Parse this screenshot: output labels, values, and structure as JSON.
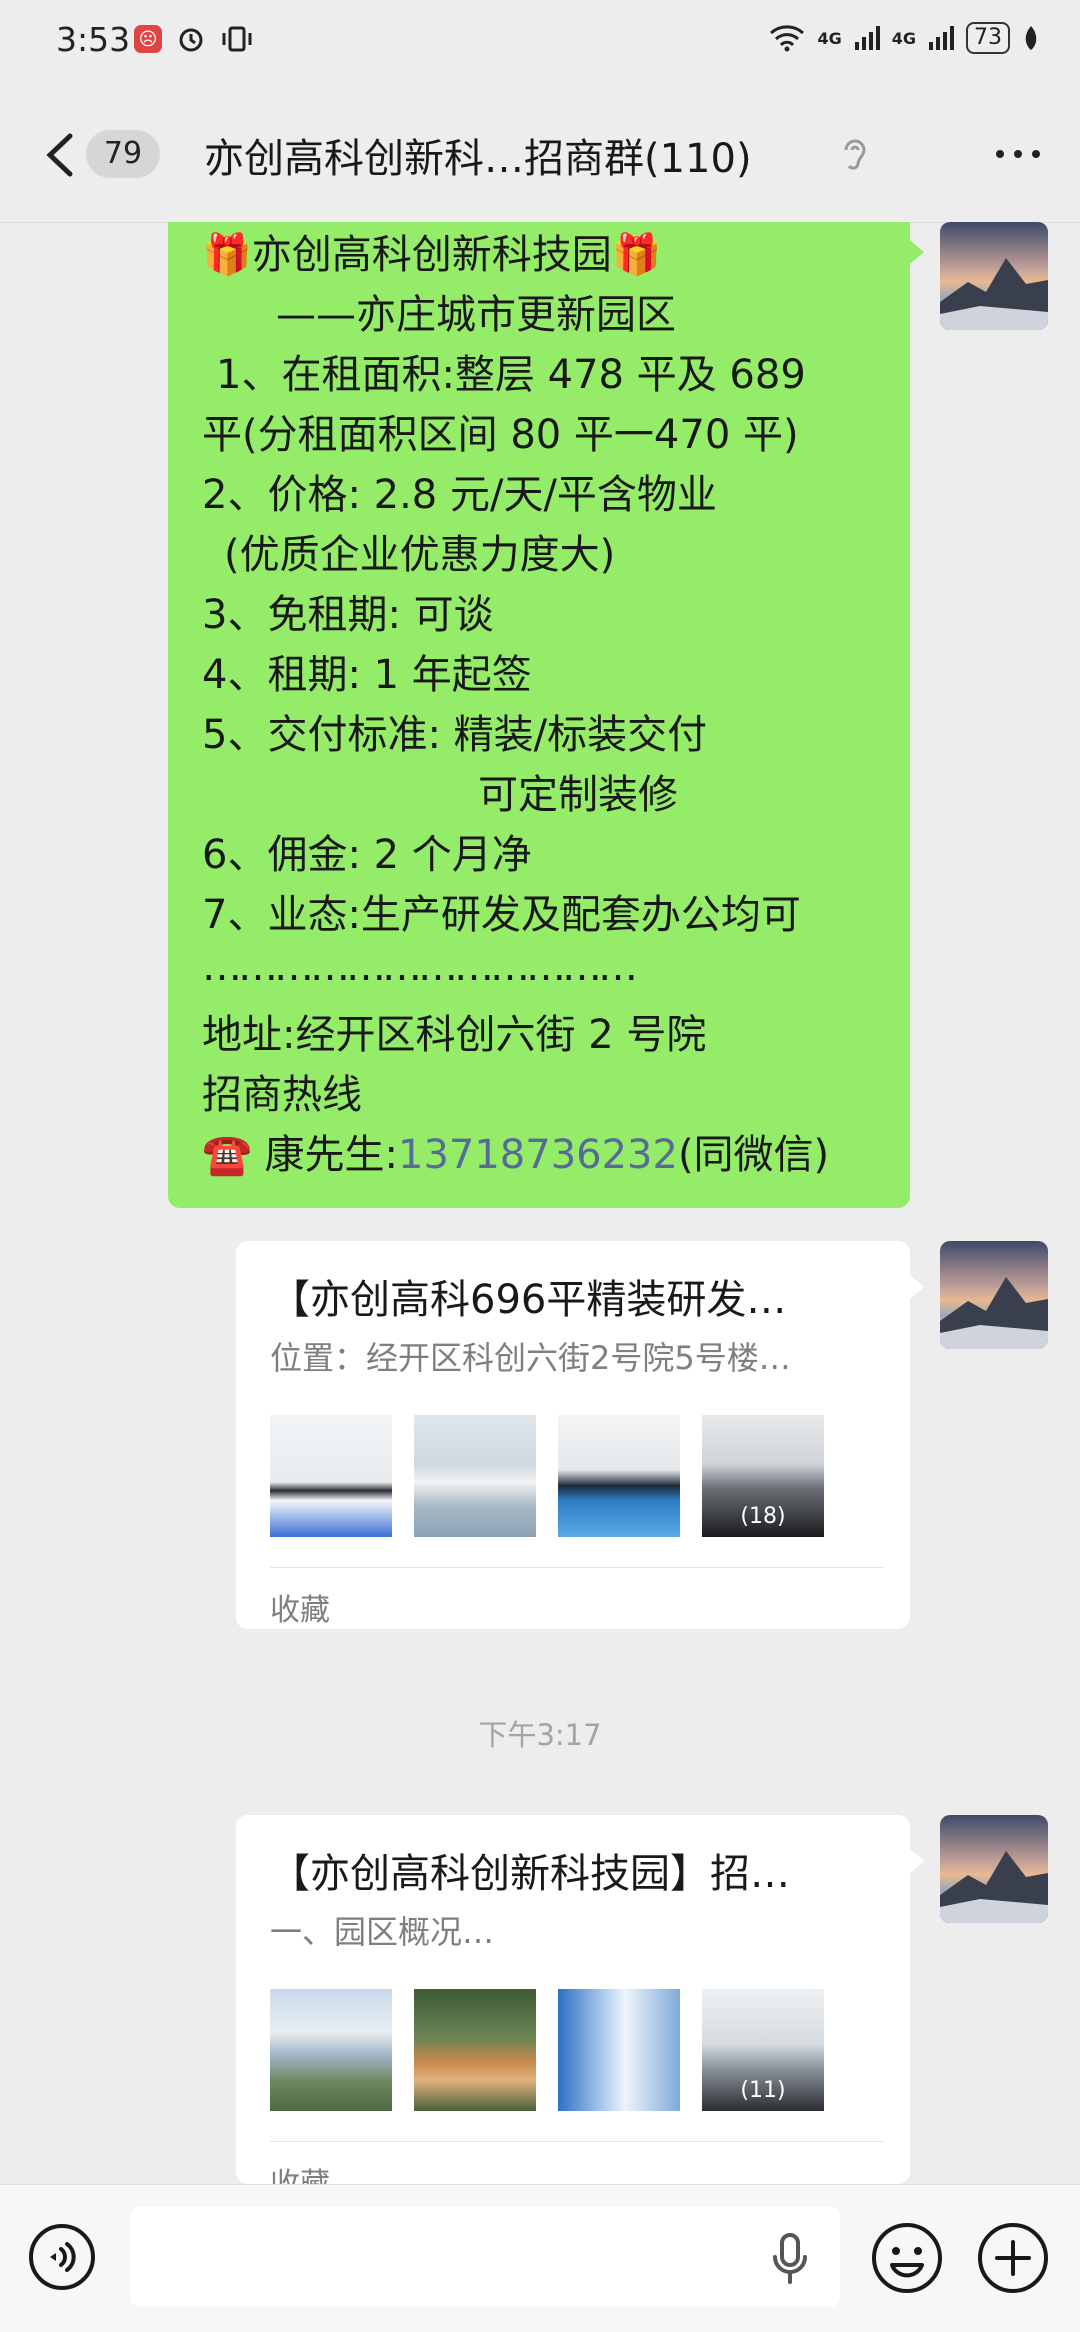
{
  "status_bar": {
    "time": "3:53",
    "network_1": "4G",
    "network_2": "4G",
    "battery": "73"
  },
  "header": {
    "unread_count": "79",
    "title": "亦创高科创新科…招商群(110)"
  },
  "message_1": {
    "lines": [
      "🎁亦创高科创新科技园🎁",
      "——亦庄城市更新园区",
      "1、在租面积:整层 478 平及 689",
      "平(分租面积区间 80 平一470 平)",
      "2、价格: 2.8 元/天/平含物业",
      "(优质企业优惠力度大)",
      "3、免租期: 可谈",
      "4、租期: 1 年起签",
      "5、交付标准: 精装/标装交付",
      "可定制装修",
      "6、佣金: 2 个月净",
      "7、业态:生产研发及配套办公均可",
      "………………………………",
      "地址:经开区科创六街 2 号院",
      "招商热线"
    ],
    "contact_prefix": "☎️ 康先生:",
    "phone": "13718736232",
    "contact_suffix": "(同微信)"
  },
  "card_1": {
    "title": "【亦创高科696平精装研发…",
    "subtitle": "位置：经开区科创六街2号院5号楼…",
    "thumb_count": "(18)",
    "footer": "收藏"
  },
  "timestamp": "下午3:17",
  "card_2": {
    "title": "【亦创高科创新科技园】招…",
    "subtitle": "一、园区概况…",
    "thumb_count": "(11)",
    "footer": "收藏"
  },
  "icons": {
    "back": "chevron-left-icon",
    "ear": "ear-icon",
    "more": "more-dots-icon",
    "voice": "voice-icon",
    "mic": "microphone-icon",
    "emoji": "emoji-icon",
    "plus": "plus-icon"
  },
  "colors": {
    "bubble_green": "#95ec69",
    "link_blue": "#576b95",
    "background": "#ededed"
  }
}
